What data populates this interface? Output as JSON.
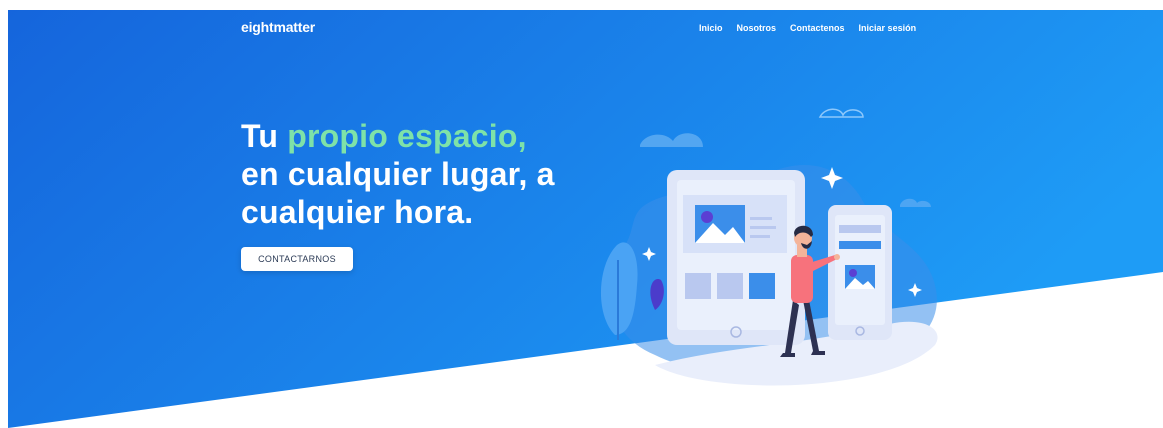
{
  "header": {
    "brand": "eightmatter",
    "nav": [
      "Inicio",
      "Nosotros",
      "Contactenos",
      "Iniciar sesión"
    ]
  },
  "hero": {
    "headline_lead": "Tu",
    "headline_accent": "propio espacio,",
    "headline_line2": "en cualquier lugar, a",
    "headline_line3": "cualquier hora.",
    "cta_label": "CONTACTARNOS"
  },
  "colors": {
    "gradient_start": "#1565dc",
    "gradient_end": "#1e9cf6",
    "accent_text": "#7ee2a8",
    "button_bg": "#ffffff"
  },
  "icons": [
    "hero-illustration",
    "sparkle-icon",
    "cloud-icon",
    "image-icon"
  ]
}
